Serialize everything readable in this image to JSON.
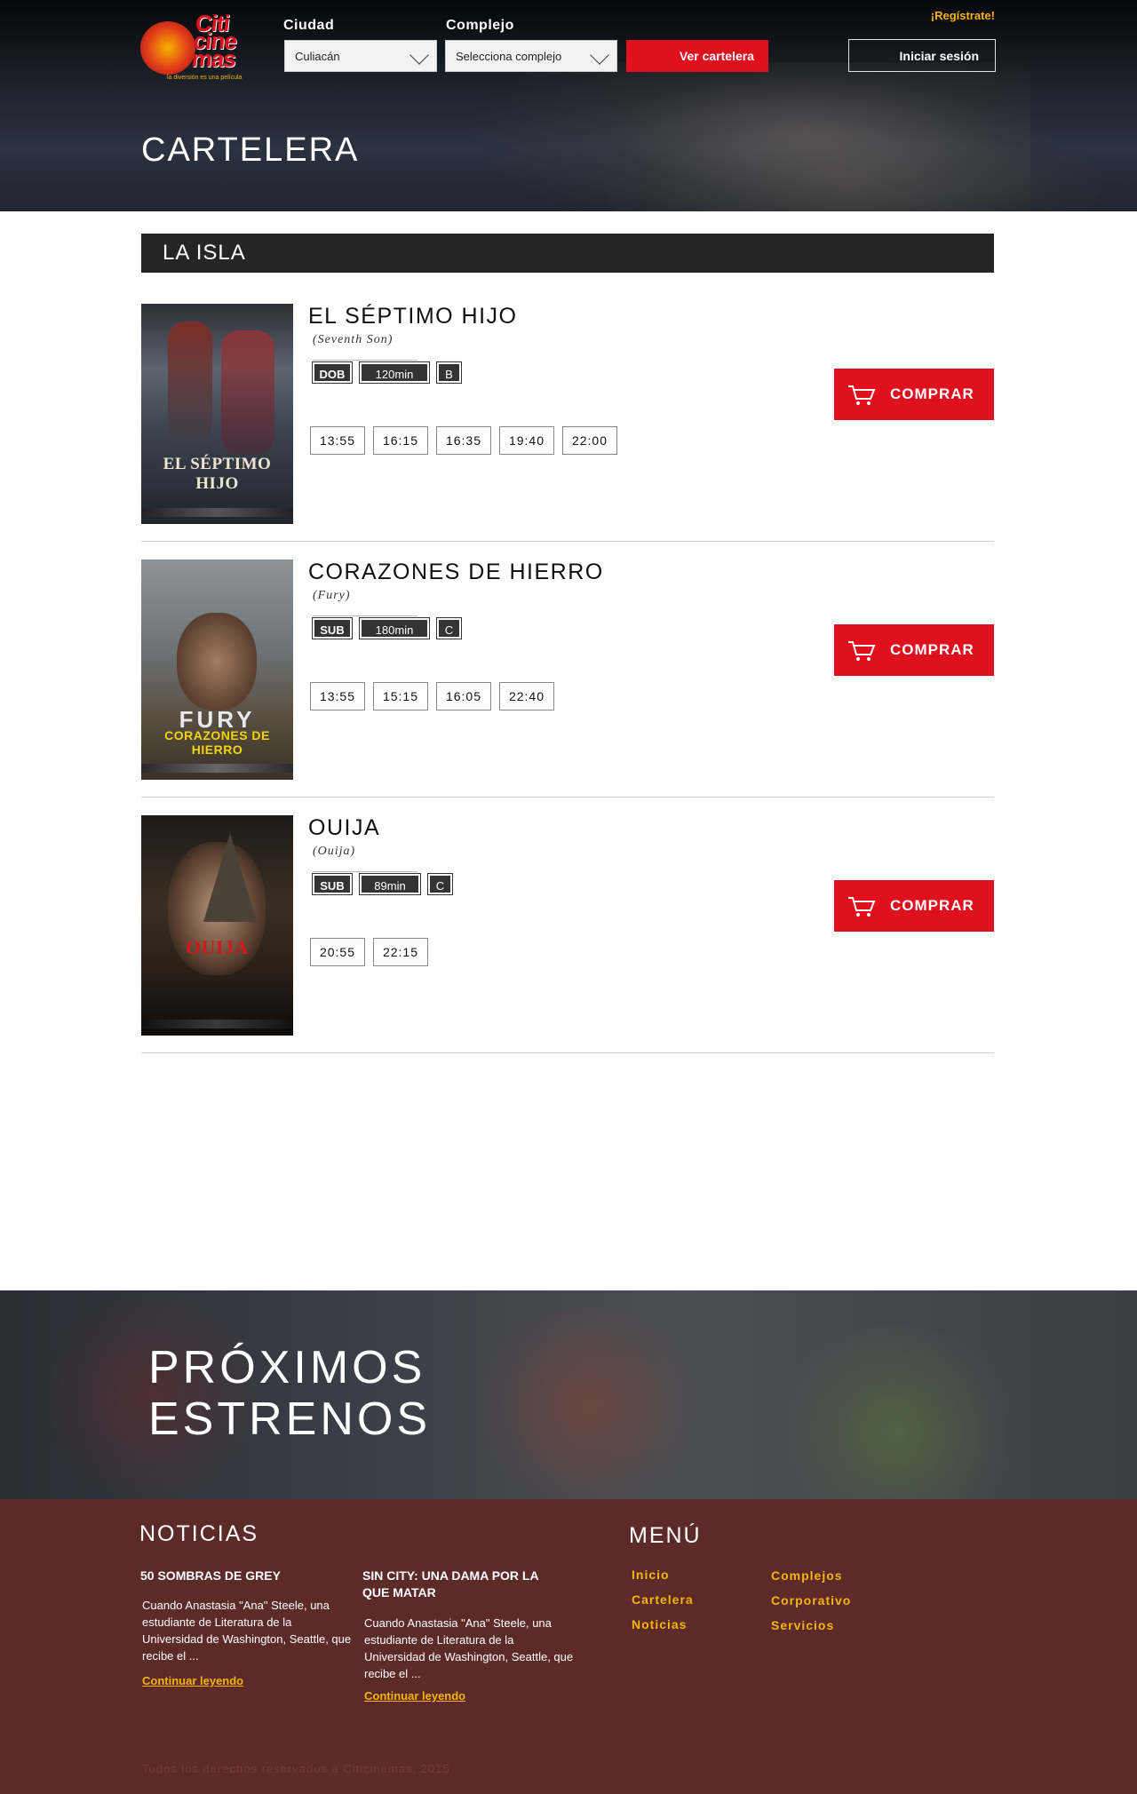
{
  "header": {
    "logo_text": "Citi cine mas",
    "logo_tagline": "la diversión es una película",
    "city_label": "Ciudad",
    "city_value": "Culiacán",
    "complex_label": "Complejo",
    "complex_value": "Selecciona complejo",
    "view_button": "Ver cartelera",
    "register_link": "¡Regístrate!",
    "login_button": "Iniciar sesión",
    "page_title": "CARTELERA"
  },
  "section": {
    "title": "LA ISLA"
  },
  "movies": [
    {
      "title": "EL SÉPTIMO HIJO",
      "original": "(Seventh Son)",
      "lang": "DOB",
      "duration": "120min",
      "rating": "B",
      "poster_text": "EL SÉPTIMO HIJO",
      "times": [
        "13:55",
        "16:15",
        "16:35",
        "19:40",
        "22:00"
      ],
      "buy_label": "COMPRAR"
    },
    {
      "title": "CORAZONES DE HIERRO",
      "original": "(Fury)",
      "lang": "SUB",
      "duration": "180min",
      "rating": "C",
      "poster_text": "CORAZONES DE HIERRO",
      "times": [
        "13:55",
        "15:15",
        "16:05",
        "22:40"
      ],
      "buy_label": "COMPRAR"
    },
    {
      "title": "OUIJA",
      "original": "(Ouija)",
      "lang": "SUB",
      "duration": "89min",
      "rating": "C",
      "poster_text": "OUIJA",
      "times": [
        "20:55",
        "22:15"
      ],
      "buy_label": "COMPRAR"
    }
  ],
  "upcoming": {
    "line1": "PRÓXIMOS",
    "line2": "ESTRENOS"
  },
  "footer": {
    "news_heading": "NOTICIAS",
    "menu_heading": "MENÚ",
    "news": [
      {
        "title": "50 SOMBRAS DE GREY",
        "body": "Cuando Anastasia \"Ana\" Steele, una estudiante de Literatura de la Universidad de Washington, Seattle, que recibe el ...",
        "link": "Continuar leyendo"
      },
      {
        "title": "SIN CITY: UNA DAMA POR LA QUE MATAR",
        "body": "Cuando Anastasia \"Ana\" Steele, una estudiante de Literatura de la Universidad de Washington, Seattle, que recibe el ...",
        "link": "Continuar leyendo"
      }
    ],
    "menu": [
      "Inicio",
      "Cartelera",
      "Noticias",
      "Complejos",
      "Corporativo",
      "Servicios"
    ],
    "copyright": "Todos los derechos reservados a Citicinemas, 2015"
  },
  "colors": {
    "accent": "#e0101c",
    "gold": "#f5b400",
    "footer": "#5c2a29",
    "bar": "#252525"
  },
  "icons": [
    "chevron-down-icon",
    "cart-icon"
  ]
}
